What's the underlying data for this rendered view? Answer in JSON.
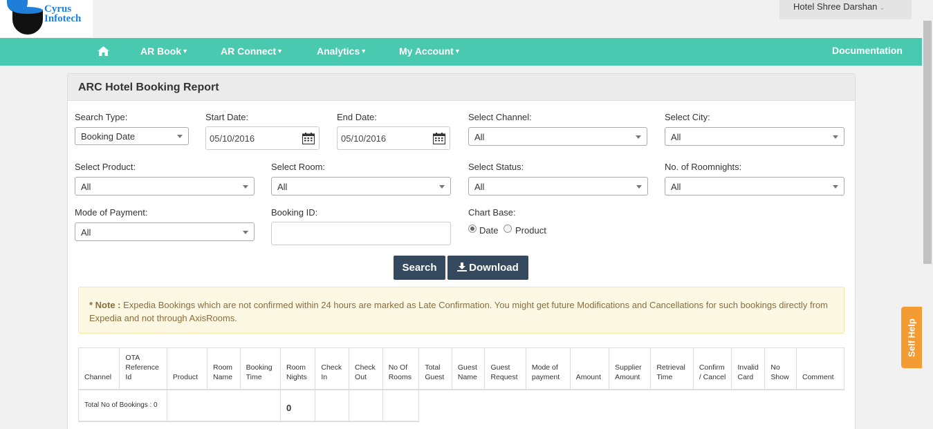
{
  "brand": {
    "line1": "Cyrus",
    "line2": "Infotech"
  },
  "hotel": {
    "name": "Hotel Shree Darshan"
  },
  "nav": {
    "items": [
      "AR Book",
      "AR Connect",
      "Analytics",
      "My Account"
    ],
    "documentation": "Documentation"
  },
  "panel": {
    "title": "ARC Hotel Booking Report"
  },
  "filters": {
    "search_type": {
      "label": "Search Type:",
      "value": "Booking Date"
    },
    "start_date": {
      "label": "Start Date:",
      "value": "05/10/2016"
    },
    "end_date": {
      "label": "End Date:",
      "value": "05/10/2016"
    },
    "channel": {
      "label": "Select Channel:",
      "value": "All"
    },
    "city": {
      "label": "Select City:",
      "value": "All"
    },
    "product": {
      "label": "Select Product:",
      "value": "All"
    },
    "room": {
      "label": "Select Room:",
      "value": "All"
    },
    "status": {
      "label": "Select Status:",
      "value": "All"
    },
    "roomnights": {
      "label": "No. of Roomnights:",
      "value": "All"
    },
    "payment": {
      "label": "Mode of Payment:",
      "value": "All"
    },
    "booking_id": {
      "label": "Booking ID:",
      "value": ""
    },
    "chart_base": {
      "label": "Chart Base:",
      "options": [
        "Date",
        "Product"
      ],
      "selected": "Date"
    }
  },
  "buttons": {
    "search": "Search",
    "download": "Download"
  },
  "note": {
    "prefix": "* Note :",
    "text": "Expedia Bookings which are not confirmed within 24 hours are marked as Late Confirmation. You might get future Modifications and Cancellations for such bookings directly from Expedia and not through AxisRooms."
  },
  "table": {
    "headers": [
      "Channel",
      "OTA Reference Id",
      "Product",
      "Room Name",
      "Booking Time",
      "Room Nights",
      "Check In",
      "Check Out",
      "No Of Rooms",
      "Total Guest",
      "Guest Name",
      "Guest Request",
      "Mode of payment",
      "Amount",
      "Supplier Amount",
      "Retrieval Time",
      "Confirm / Cancel",
      "Invalid Card",
      "No Show",
      "Comment"
    ],
    "total_label": "Total No of Bookings : 0",
    "total_room_nights": "0"
  },
  "self_help": "Self Help"
}
